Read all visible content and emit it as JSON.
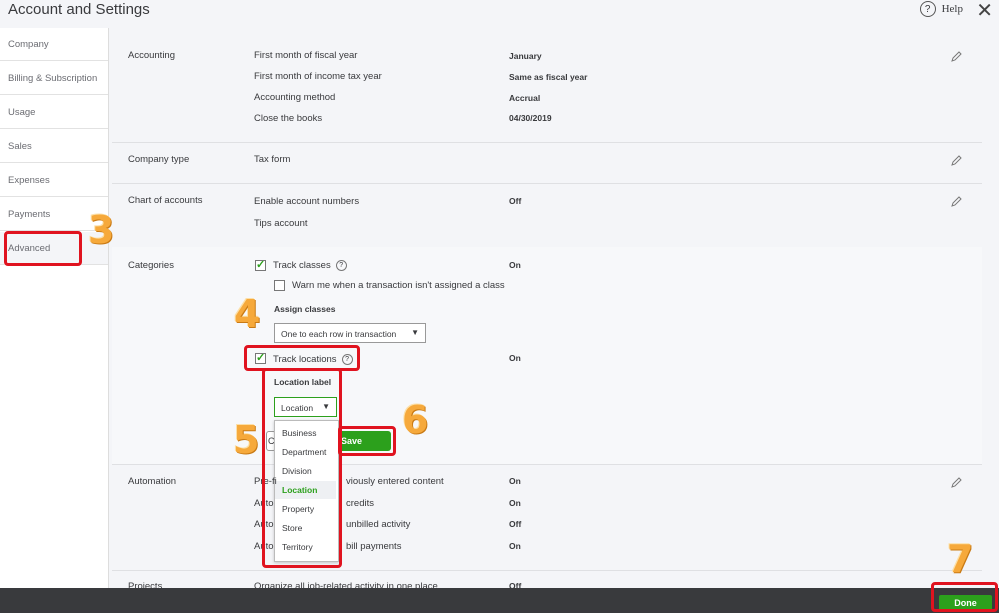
{
  "window": {
    "title": "Account and Settings",
    "help_label": "Help"
  },
  "sidebar": {
    "items": [
      {
        "label": "Company"
      },
      {
        "label": "Billing & Subscription"
      },
      {
        "label": "Usage"
      },
      {
        "label": "Sales"
      },
      {
        "label": "Expenses"
      },
      {
        "label": "Payments"
      },
      {
        "label": "Advanced"
      }
    ]
  },
  "accounting": {
    "title": "Accounting",
    "rows": [
      {
        "label": "First month of fiscal year",
        "value": "January"
      },
      {
        "label": "First month of income tax year",
        "value": "Same as fiscal year"
      },
      {
        "label": "Accounting method",
        "value": "Accrual"
      },
      {
        "label": "Close the books",
        "value": "04/30/2019"
      }
    ]
  },
  "company_type": {
    "title": "Company type",
    "label": "Tax form"
  },
  "chart_of_accounts": {
    "title": "Chart of accounts",
    "rows": [
      {
        "label": "Enable account numbers",
        "value": "Off"
      },
      {
        "label": "Tips account",
        "value": ""
      }
    ]
  },
  "categories": {
    "title": "Categories",
    "track_classes": {
      "label": "Track classes",
      "value": "On",
      "checked": true
    },
    "warn": {
      "label": "Warn me when a transaction isn't assigned a class",
      "checked": false
    },
    "assign_classes": {
      "label": "Assign classes",
      "selected": "One to each row in transaction"
    },
    "track_locations": {
      "label": "Track locations",
      "value": "On",
      "checked": true
    },
    "location_label": {
      "label": "Location label",
      "selected": "Location"
    },
    "dropdown_options": [
      "Business",
      "Department",
      "Division",
      "Location",
      "Property",
      "Store",
      "Territory"
    ],
    "cancel_label": "C",
    "save_label": "Save"
  },
  "automation": {
    "title": "Automation",
    "rows": [
      {
        "label_left": "Pre-fi",
        "label_right": "viously entered content",
        "value": "On"
      },
      {
        "label_left": "Auto",
        "label_right": "credits",
        "value": "On"
      },
      {
        "label_left": "Auto",
        "label_right": "unbilled activity",
        "value": "Off"
      },
      {
        "label_left": "Auto",
        "label_right": "bill payments",
        "value": "On"
      }
    ]
  },
  "projects": {
    "title": "Projects",
    "label": "Organize all job-related activity in one place",
    "value": "Off"
  },
  "footer": {
    "done_label": "Done"
  },
  "annotations": {
    "n3": "3",
    "n4": "4",
    "n5": "5",
    "n6": "6",
    "n7": "7"
  },
  "colors": {
    "green": "#2ca01c",
    "red_box": "#e0131f",
    "annotation_orange": "#f6a93b",
    "footer": "#393a3d"
  }
}
